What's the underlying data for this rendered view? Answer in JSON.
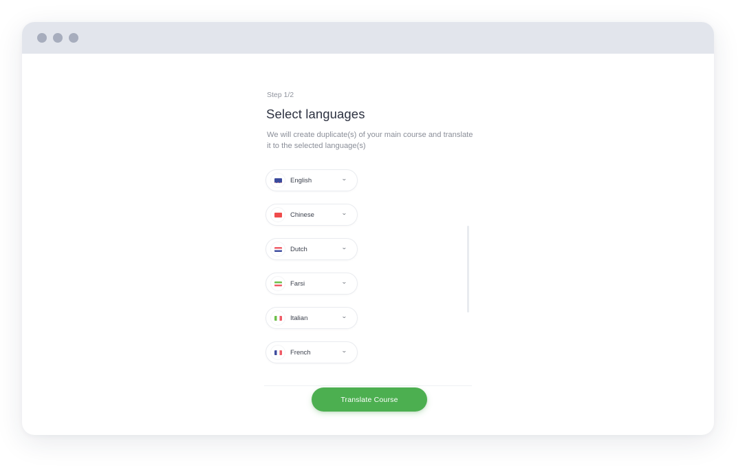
{
  "window": {
    "controls": [
      "close",
      "minimize",
      "maximize"
    ]
  },
  "wizard": {
    "step": "Step 1/2",
    "title": "Select languages",
    "description": "We will create duplicate(s) of your main course and translate it to the selected language(s)"
  },
  "languages": [
    {
      "label": "English",
      "flag": "uk-flag-icon"
    },
    {
      "label": "Chinese",
      "flag": "china-flag-icon"
    },
    {
      "label": "Dutch",
      "flag": "netherlands-flag-icon"
    },
    {
      "label": "Farsi",
      "flag": "iran-flag-icon"
    },
    {
      "label": "Italian",
      "flag": "italy-flag-icon"
    },
    {
      "label": "French",
      "flag": "france-flag-icon"
    }
  ],
  "chevron": "⌄",
  "cta": {
    "label": "Translate Course",
    "color": "#4caf50"
  }
}
